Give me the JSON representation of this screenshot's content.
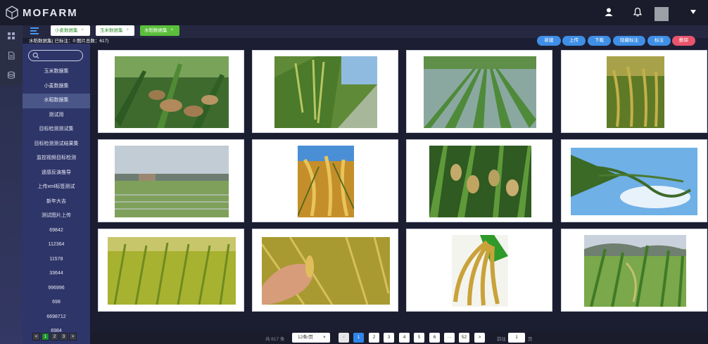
{
  "app": {
    "brand": "MOFARM"
  },
  "header": {
    "user_icon": "user-icon",
    "bell_icon": "bell-icon",
    "caret_icon": "caret-down-icon"
  },
  "rail": {
    "icons": [
      "grid-icon",
      "document-icon",
      "database-icon"
    ]
  },
  "tabs": [
    {
      "label": "小麦数据集",
      "active": false
    },
    {
      "label": "玉米数据集",
      "active": false
    },
    {
      "label": "水稻数据集",
      "active": true
    }
  ],
  "toolbar": {
    "dataset_info": "水稻数据集( 已标注：0 图片总数：617)",
    "buttons": [
      "新建",
      "上传",
      "下载",
      "隐藏标注",
      "标注",
      "删除"
    ]
  },
  "sidebar": {
    "search_placeholder": "",
    "items": [
      {
        "label": "玉米数据集",
        "active": false
      },
      {
        "label": "小麦数据集",
        "active": false
      },
      {
        "label": "水稻数据集",
        "active": true
      },
      {
        "label": "测试用",
        "active": false
      },
      {
        "label": "目标检测测试集",
        "active": false
      },
      {
        "label": "目标检测测试结果集",
        "active": false
      },
      {
        "label": "监控视频目标检测",
        "active": false
      },
      {
        "label": "遥感反演推导",
        "active": false
      },
      {
        "label": "上传xml标签测试",
        "active": false
      },
      {
        "label": "新年大吉",
        "active": false
      },
      {
        "label": "测试图片上传",
        "active": false
      },
      {
        "label": "69842",
        "active": false
      },
      {
        "label": "112364",
        "active": false
      },
      {
        "label": "11578",
        "active": false
      },
      {
        "label": "33644",
        "active": false
      },
      {
        "label": "996996",
        "active": false
      },
      {
        "label": "698",
        "active": false
      },
      {
        "label": "6698712",
        "active": false
      },
      {
        "label": "6984",
        "active": false
      }
    ],
    "pager": [
      "<",
      "1",
      "2",
      "3",
      ">"
    ]
  },
  "gallery": {
    "images": [
      "rice-closeup-1",
      "rice-field-path",
      "paddy-rows",
      "rice-ear-sun",
      "paddy-village",
      "golden-rice",
      "rice-panicles",
      "rice-sky",
      "yellow-field",
      "rice-hand",
      "rice-bundle",
      "green-rice-hills"
    ]
  },
  "pagination": {
    "total": "共 617 条",
    "page_size": "12条/页",
    "pages": [
      "<",
      "1",
      "2",
      "3",
      "4",
      "5",
      "6",
      "···",
      "52",
      ">"
    ],
    "current": "1",
    "goto_label": "前往",
    "goto_value": "1",
    "unit": "页"
  }
}
